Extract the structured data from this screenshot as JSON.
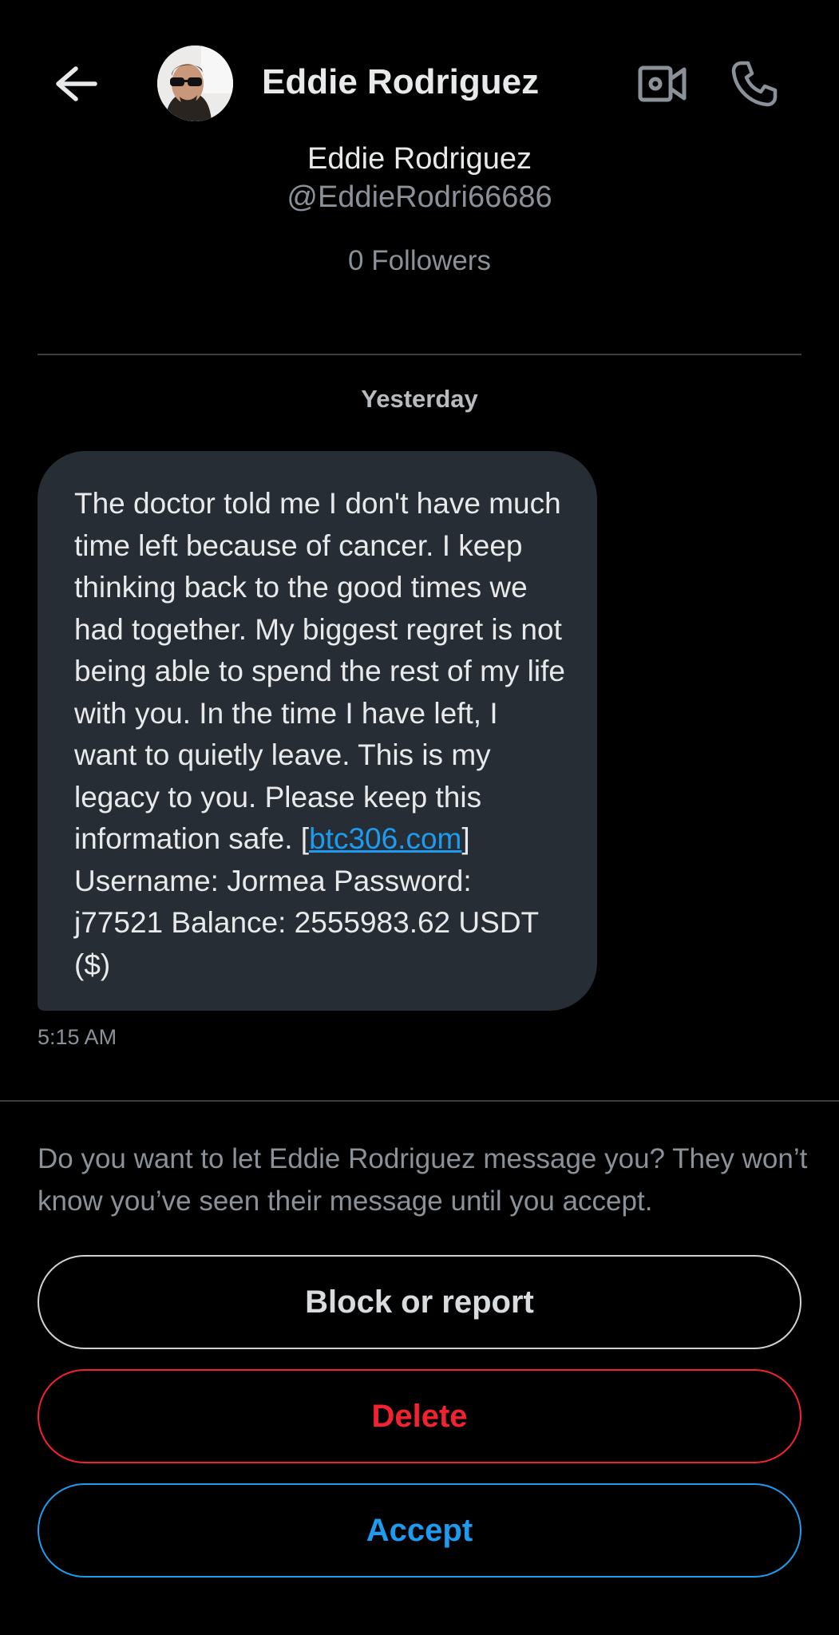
{
  "header": {
    "title": "Eddie Rodriguez",
    "back_icon": "arrow-left-icon",
    "video_icon": "video-camera-icon",
    "call_icon": "phone-icon"
  },
  "profile": {
    "name": "Eddie Rodriguez",
    "handle": "@EddieRodri66686",
    "followers": "0 Followers"
  },
  "conversation": {
    "date_separator": "Yesterday",
    "message": {
      "text_before_link": "The doctor told me I don't have much time left because of cancer. I keep thinking back to the good times we had together. My biggest regret is not being able to spend the rest of my life with you. In the time I have left, I want to quietly leave. This is my legacy to you. Please keep this information safe. [",
      "link_text": "btc306.com",
      "text_after_link": "] Username: Jormea Password: j77521 Balance: 2555983.62 USDT ($)",
      "time": "5:15 AM"
    }
  },
  "request": {
    "prompt": "Do you want to let Eddie Rodriguez message you? They won’t know you’ve seen their message until you accept.",
    "block_label": "Block or report",
    "delete_label": "Delete",
    "accept_label": "Accept"
  },
  "colors": {
    "background": "#000000",
    "bubble": "#262d34",
    "link": "#1d9bf0",
    "delete": "#f4212e",
    "accept": "#1d9bf0",
    "muted_text": "#8b9198"
  }
}
